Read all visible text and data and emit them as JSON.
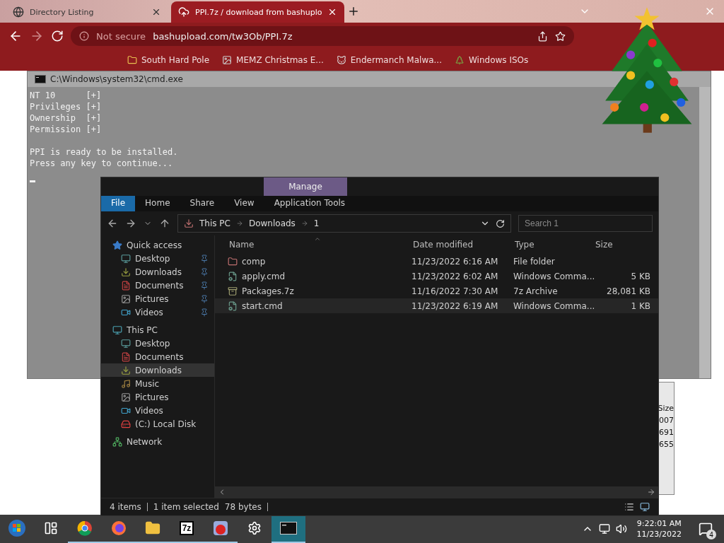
{
  "browser": {
    "tabs": [
      {
        "title": "Directory Listing",
        "selected": false,
        "kind": "globe"
      },
      {
        "title": "PPI.7z / download from bashuplo",
        "selected": true,
        "kind": "upload"
      }
    ],
    "address": {
      "security": "Not secure",
      "url": "bashupload.com/tw3Ob/PPI.7z"
    },
    "bookmarks": [
      {
        "label": "South Hard Pole",
        "kind": "folder"
      },
      {
        "label": "MEMZ Christmas E...",
        "kind": "image"
      },
      {
        "label": "Endermanch Malwa...",
        "kind": "cat"
      },
      {
        "label": "Windows ISOs",
        "kind": "tree"
      }
    ]
  },
  "console": {
    "title": "C:\\Windows\\system32\\cmd.exe",
    "blocks": [
      [
        "NT 10      [+]",
        "Privileges [+]",
        "Ownership  [+]",
        "Permission [+]"
      ],
      [
        "PPI is ready to be installed.",
        "Press any key to continue..."
      ]
    ]
  },
  "explorer": {
    "context_tab": "Manage",
    "ribbon_tabs": [
      {
        "label": "File",
        "kind": "menu",
        "selected": false
      },
      {
        "label": "Home",
        "kind": "tab",
        "selected": false
      },
      {
        "label": "Share",
        "kind": "tab",
        "selected": false
      },
      {
        "label": "View",
        "kind": "tab",
        "selected": false
      },
      {
        "label": "Application Tools",
        "kind": "tab",
        "selected": false
      }
    ],
    "breadcrumb": [
      "This PC",
      "Downloads",
      "1"
    ],
    "search": {
      "placeholder": "Search 1"
    },
    "nav": [
      {
        "label": "Quick access",
        "kind": "star",
        "selected": false,
        "children": [
          {
            "label": "Desktop",
            "kind": "desktop",
            "pinned": true,
            "selected": false
          },
          {
            "label": "Downloads",
            "kind": "downloads",
            "pinned": true,
            "selected": false
          },
          {
            "label": "Documents",
            "kind": "documents",
            "pinned": true,
            "selected": false
          },
          {
            "label": "Pictures",
            "kind": "pictures",
            "pinned": true,
            "selected": false
          },
          {
            "label": "Videos",
            "kind": "videos",
            "pinned": true,
            "selected": false
          }
        ]
      },
      {
        "label": "This PC",
        "kind": "pc",
        "selected": false,
        "children": [
          {
            "label": "Desktop",
            "kind": "desktop",
            "pinned": false,
            "selected": false
          },
          {
            "label": "Documents",
            "kind": "documents",
            "pinned": false,
            "selected": false
          },
          {
            "label": "Downloads",
            "kind": "downloads",
            "pinned": false,
            "selected": true
          },
          {
            "label": "Music",
            "kind": "music",
            "pinned": false,
            "selected": false
          },
          {
            "label": "Pictures",
            "kind": "pictures",
            "pinned": false,
            "selected": false
          },
          {
            "label": "Videos",
            "kind": "videos",
            "pinned": false,
            "selected": false
          },
          {
            "label": "(C:) Local Disk",
            "kind": "disk",
            "pinned": false,
            "selected": false
          }
        ]
      },
      {
        "label": "Network",
        "kind": "network",
        "selected": false
      }
    ],
    "columns": [
      "Name",
      "Date modified",
      "Type",
      "Size"
    ],
    "rows": [
      {
        "name": "comp",
        "date": "11/23/2022 6:16 AM",
        "type": "File folder",
        "kind": "folder",
        "selected": false
      },
      {
        "name": "apply.cmd",
        "date": "11/23/2022 6:02 AM",
        "type": "Windows Comma...",
        "size": "5 KB",
        "kind": "script",
        "selected": false
      },
      {
        "name": "Packages.7z",
        "date": "11/16/2022 7:30 AM",
        "type": "7z Archive",
        "size": "28,081 KB",
        "kind": "archive",
        "selected": false
      },
      {
        "name": "start.cmd",
        "date": "11/23/2022 6:19 AM",
        "type": "Windows Comma...",
        "size": "1 KB",
        "kind": "script",
        "selected": true
      }
    ],
    "status": {
      "count": "4 items",
      "selection": "1 item selected",
      "size": "78 bytes"
    }
  },
  "background_window": {
    "column": "Size",
    "cells": [
      "007",
      "691",
      "655"
    ]
  },
  "taskbar": {
    "apps": [
      {
        "kind": "taskview",
        "running": false,
        "active": false
      },
      {
        "kind": "chrome",
        "running": true,
        "active": false
      },
      {
        "kind": "firefox",
        "running": true,
        "active": false
      },
      {
        "kind": "explorer",
        "running": true,
        "active": false
      },
      {
        "kind": "archiver",
        "label": "7z",
        "running": true,
        "active": false
      },
      {
        "kind": "game",
        "running": true,
        "active": false
      },
      {
        "kind": "settings",
        "running": false,
        "active": false
      },
      {
        "kind": "console",
        "running": true,
        "active": true
      }
    ],
    "clock": {
      "time": "9:22:01 AM",
      "date": "11/23/2022"
    },
    "notifications": "4"
  }
}
